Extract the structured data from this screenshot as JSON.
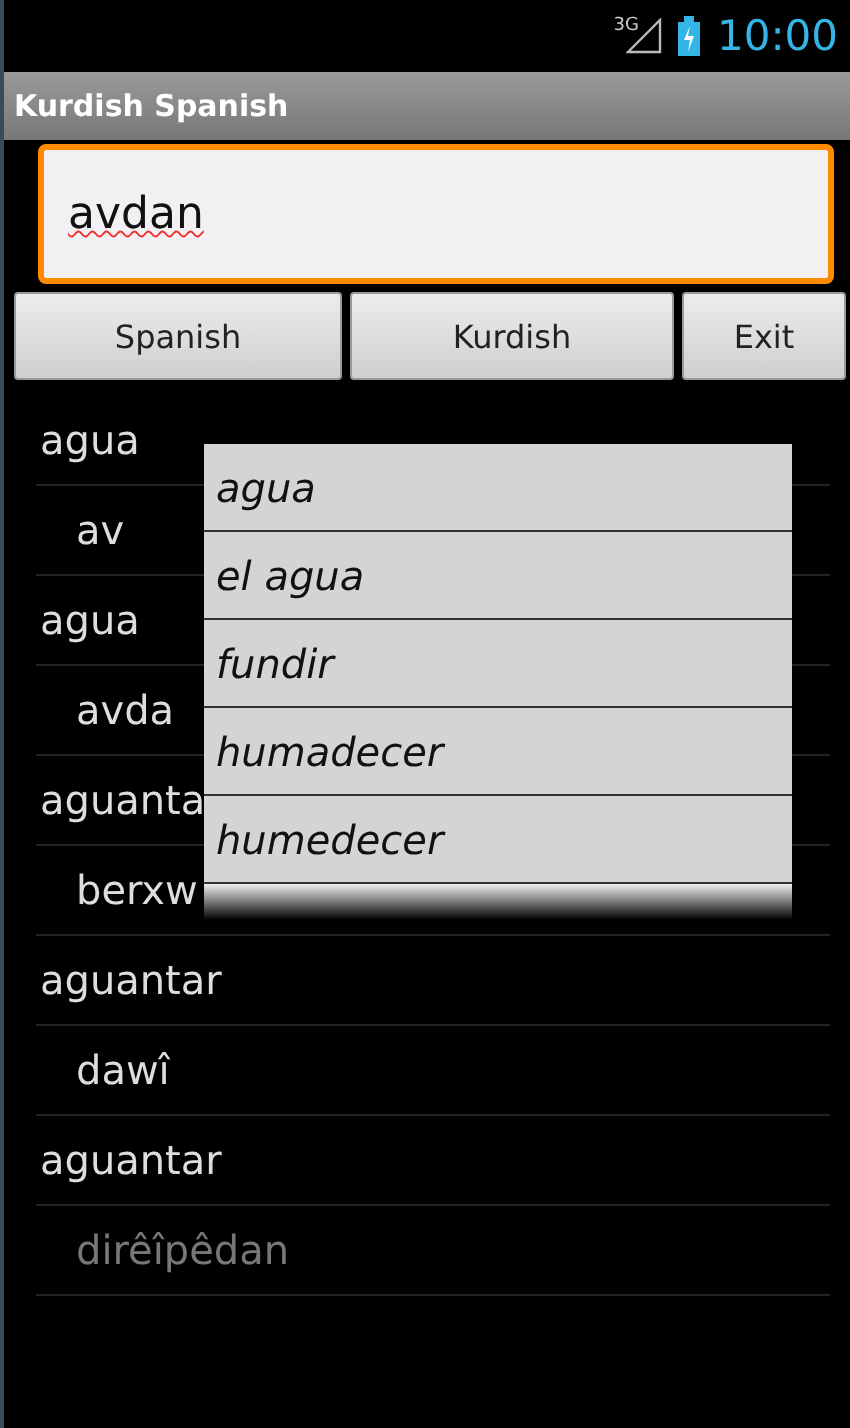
{
  "status_bar": {
    "network": "3G",
    "time": "10:00"
  },
  "window": {
    "title": "Kurdish Spanish"
  },
  "search": {
    "value": "avdan",
    "focused": true,
    "misspelled": true
  },
  "buttons": [
    "Spanish",
    "Kurdish",
    "Exit"
  ],
  "results": [
    {
      "text": "agua",
      "kind": "term"
    },
    {
      "text": "av",
      "kind": "translation"
    },
    {
      "text": "agua",
      "kind": "term"
    },
    {
      "text": "avda",
      "kind": "translation"
    },
    {
      "text": "aguanta",
      "kind": "term"
    },
    {
      "text": "berxw",
      "kind": "translation"
    },
    {
      "text": "aguantar",
      "kind": "term"
    },
    {
      "text": "dawî",
      "kind": "translation"
    },
    {
      "text": "aguantar",
      "kind": "term"
    },
    {
      "text": "dirêîpêdan",
      "kind": "translation"
    }
  ],
  "suggestions": [
    "agua",
    "el agua",
    "fundir",
    "humadecer",
    "humedecer"
  ]
}
